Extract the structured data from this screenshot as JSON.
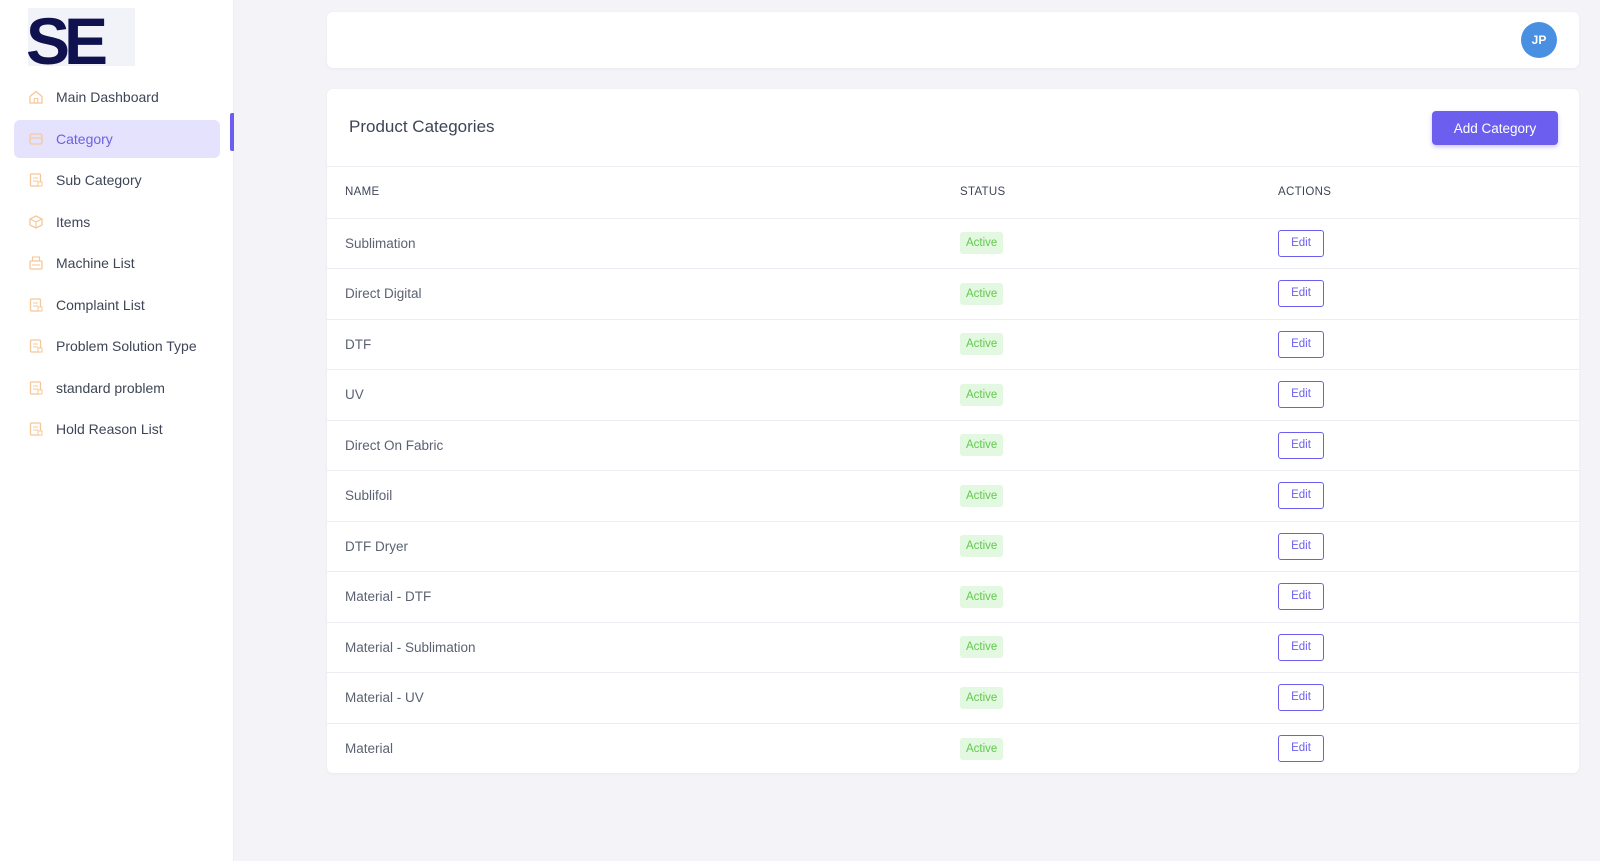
{
  "logo": {
    "text": "SE"
  },
  "sidebar": {
    "items": [
      {
        "label": "Main Dashboard",
        "icon": "home-icon",
        "active": false
      },
      {
        "label": "Category",
        "icon": "category-icon",
        "active": true
      },
      {
        "label": "Sub Category",
        "icon": "document-icon",
        "active": false
      },
      {
        "label": "Items",
        "icon": "box-icon",
        "active": false
      },
      {
        "label": "Machine List",
        "icon": "machine-icon",
        "active": false
      },
      {
        "label": "Complaint List",
        "icon": "document-icon",
        "active": false
      },
      {
        "label": "Problem Solution Type",
        "icon": "document-icon",
        "active": false
      },
      {
        "label": "standard problem",
        "icon": "document-icon",
        "active": false
      },
      {
        "label": "Hold Reason List",
        "icon": "document-icon",
        "active": false
      }
    ]
  },
  "header": {
    "avatar_initials": "JP"
  },
  "main": {
    "title": "Product Categories",
    "add_button_label": "Add Category",
    "columns": [
      "NAME",
      "STATUS",
      "ACTIONS"
    ],
    "rows": [
      {
        "name": "Sublimation",
        "status": "Active",
        "action": "Edit"
      },
      {
        "name": "Direct Digital",
        "status": "Active",
        "action": "Edit"
      },
      {
        "name": "DTF",
        "status": "Active",
        "action": "Edit"
      },
      {
        "name": "UV",
        "status": "Active",
        "action": "Edit"
      },
      {
        "name": "Direct On Fabric",
        "status": "Active",
        "action": "Edit"
      },
      {
        "name": "Sublifoil",
        "status": "Active",
        "action": "Edit"
      },
      {
        "name": "DTF Dryer",
        "status": "Active",
        "action": "Edit"
      },
      {
        "name": "Material - DTF",
        "status": "Active",
        "action": "Edit"
      },
      {
        "name": "Material - Sublimation",
        "status": "Active",
        "action": "Edit"
      },
      {
        "name": "Material - UV",
        "status": "Active",
        "action": "Edit"
      },
      {
        "name": "Material",
        "status": "Active",
        "action": "Edit"
      }
    ]
  },
  "colors": {
    "accent": "#6c5ff0",
    "active_nav_bg": "#e4e2fd",
    "status_badge_bg": "#e3f8e0",
    "status_badge_text": "#62c94e",
    "avatar_bg": "#4a90e2",
    "logo_color": "#101250",
    "icon_color": "#f5c89a"
  }
}
